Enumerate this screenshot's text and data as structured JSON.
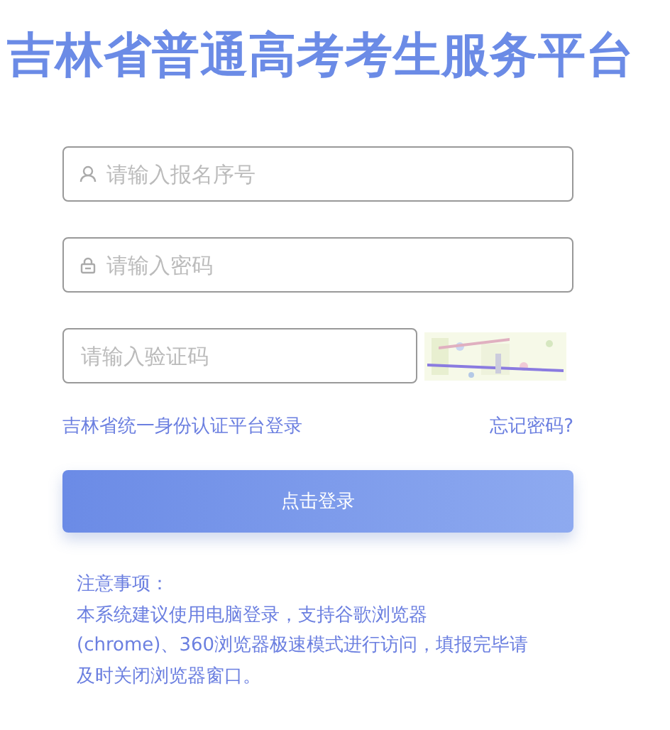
{
  "title": "吉林省普通高考考生服务平台",
  "fields": [
    {
      "kind": "user",
      "placeholder": "请输入报名序号"
    },
    {
      "kind": "lock",
      "placeholder": "请输入密码"
    },
    {
      "kind": "captcha",
      "placeholder": "请输入验证码"
    }
  ],
  "links": [
    "吉林省统一身份认证平台登录",
    "忘记密码?"
  ],
  "login_button": "点击登录",
  "notes": [
    "注意事项：",
    "本系统建议使用电脑登录，支持谷歌浏览器",
    "(chrome)、360浏览器极速模式进行访问，填报完毕请",
    "及时关闭浏览器窗口。"
  ]
}
